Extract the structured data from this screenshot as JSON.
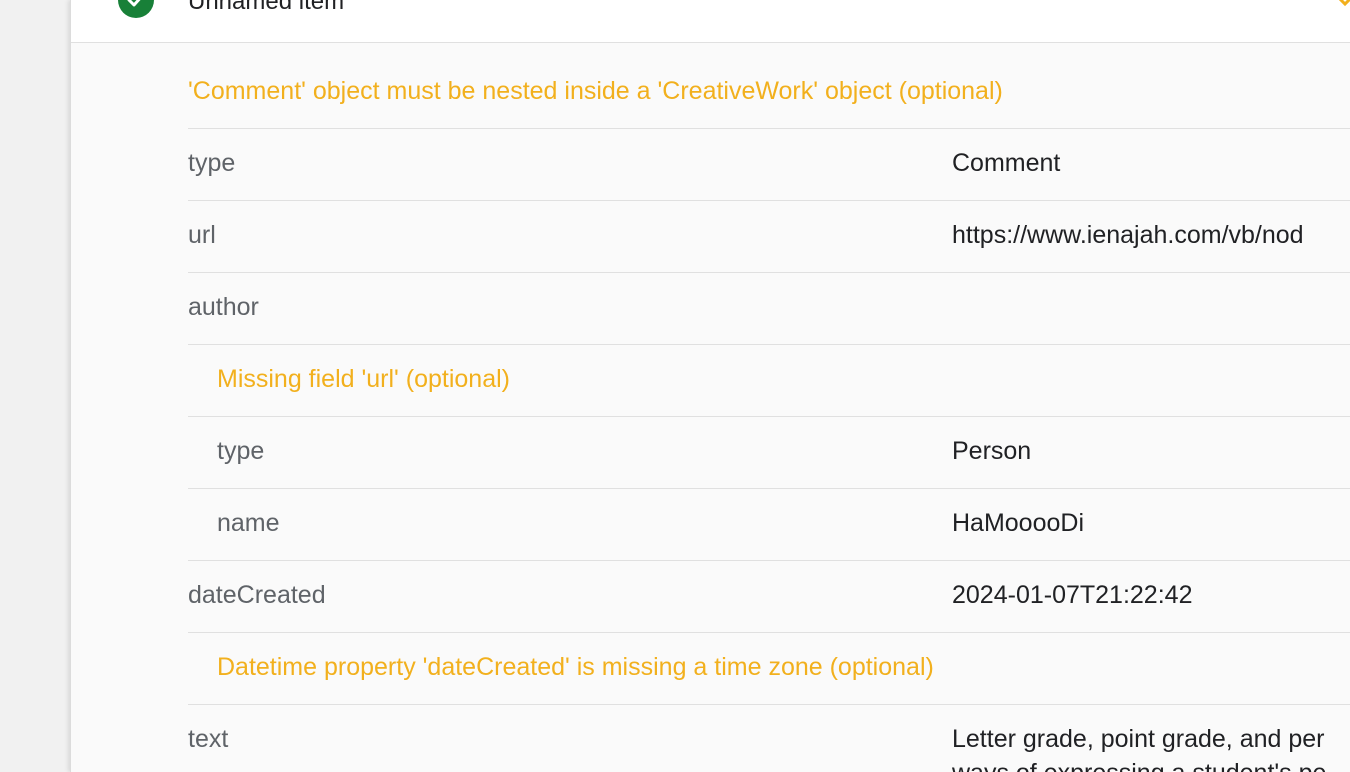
{
  "item": {
    "title": "Unnamed item"
  },
  "colors": {
    "warning": "#f2b01d",
    "valid": "#188038",
    "label": "#5f6368",
    "value": "#202124"
  },
  "icons": {
    "status": "check-circle-icon",
    "toggle": "chevron-icon"
  },
  "rows": {
    "w0": "'Comment' object must be nested inside a 'CreativeWork' object (optional)",
    "r1": {
      "prop": "type",
      "value": "Comment"
    },
    "r2": {
      "prop": "url",
      "value": "https://www.ienajah.com/vb/nod"
    },
    "r3": {
      "prop": "author"
    },
    "w4": "Missing field 'url' (optional)",
    "r5": {
      "prop": "type",
      "value": "Person"
    },
    "r6": {
      "prop": "name",
      "value": "HaMooooDi"
    },
    "r7": {
      "prop": "dateCreated",
      "value": "2024-01-07T21:22:42"
    },
    "w8": "Datetime property 'dateCreated' is missing a time zone (optional)",
    "r9": {
      "prop": "text",
      "value": "Letter grade, point grade, and per",
      "value_line2": "ways of expressing a student's pe"
    }
  }
}
